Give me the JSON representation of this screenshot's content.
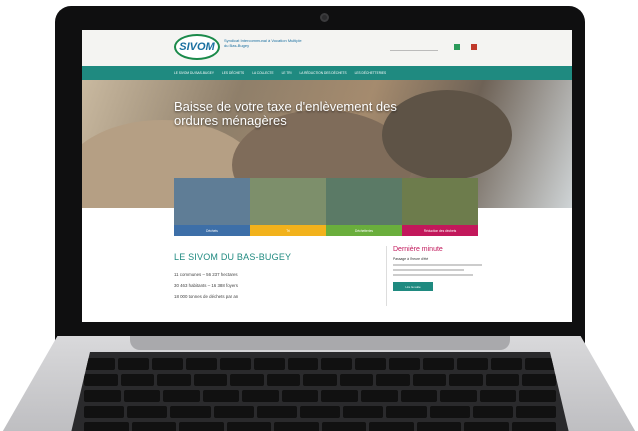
{
  "site": {
    "logo_text": "SIVOM",
    "org_name": "Syndicat Intercommunal à Vocation Multiple du Bas-Bugey",
    "nav": [
      "LE SIVOM DU BAS-BUGEY",
      "LES DÉCHETS",
      "LA COLLECTE",
      "LE TRI",
      "LA RÉDUCTION DES DÉCHETS",
      "LES DÉCHETTERIES"
    ],
    "hero_title": "Baisse de votre taxe d'enlèvement des ordures ménagères",
    "tiles": [
      {
        "label": "Déchets",
        "color": "#3d6fa8",
        "img_color": "#5f7d96"
      },
      {
        "label": "Tri",
        "color": "#f2b21c",
        "img_color": "#7d8f6b"
      },
      {
        "label": "Déchetteries",
        "color": "#6aae3c",
        "img_color": "#5b7a66"
      },
      {
        "label": "Réduction des déchets",
        "color": "#c2185b",
        "img_color": "#6d7c4c"
      }
    ],
    "section_heading": "LE SIVOM DU BAS-BUGEY",
    "facts": [
      "11 communes – 56 237 hectares",
      "30 463 habitants – 16 388 foyers",
      "18 000 tonnes de déchets par an"
    ],
    "news": {
      "title": "Dernière minute",
      "subtitle": "Passage à l'heure d'été",
      "button": "Lire la suite"
    },
    "colors": {
      "teal": "#1f8a80",
      "magenta": "#c2185b"
    }
  }
}
